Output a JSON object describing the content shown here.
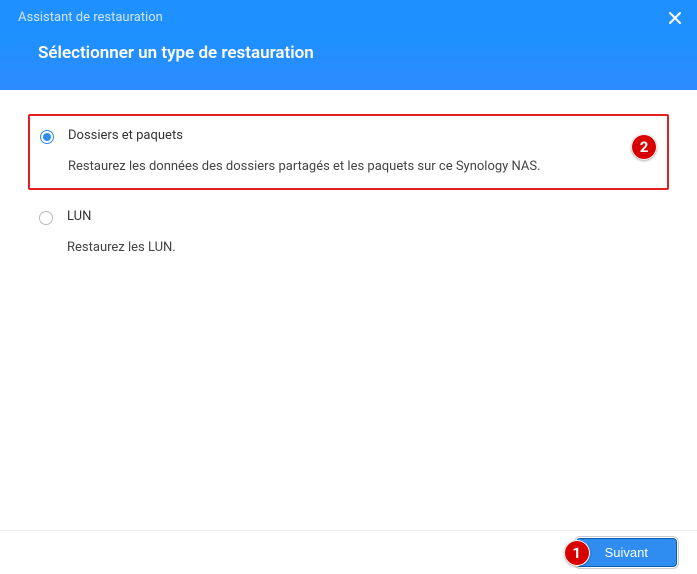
{
  "header": {
    "title": "Assistant de restauration",
    "subtitle": "Sélectionner un type de restauration"
  },
  "options": {
    "folders": {
      "label": "Dossiers et paquets",
      "desc": "Restaurez les données des dossiers partagés et les paquets sur ce Synology NAS."
    },
    "lun": {
      "label": "LUN",
      "desc": "Restaurez les LUN."
    }
  },
  "annotations": {
    "badge1": "1",
    "badge2": "2"
  },
  "footer": {
    "next": "Suivant"
  }
}
